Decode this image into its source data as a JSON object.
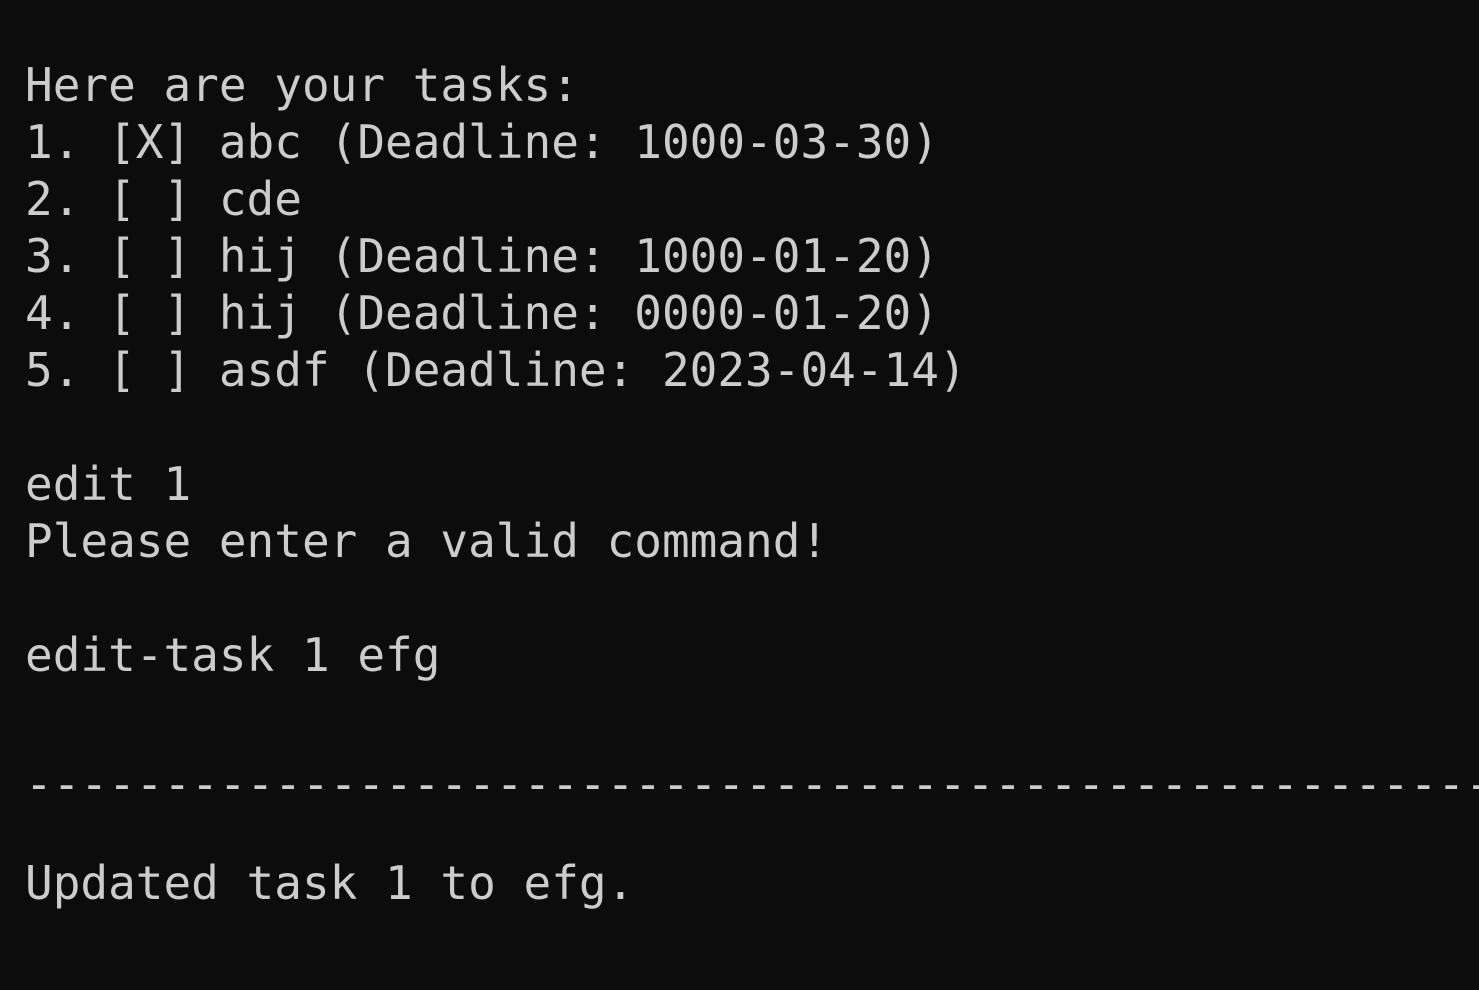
{
  "terminal": {
    "header": "Here are your tasks:",
    "tasks": [
      "1. [X] abc (Deadline: 1000-03-30)",
      "2. [ ] cde",
      "3. [ ] hij (Deadline: 1000-01-20)",
      "4. [ ] hij (Deadline: 0000-01-20)",
      "5. [ ] asdf (Deadline: 2023-04-14)"
    ],
    "command_1": "edit 1",
    "error_message": "Please enter a valid command!",
    "command_2": "edit-task 1 efg",
    "separator": "------------------------------------------------------------------------",
    "result_message": "Updated task 1 to efg."
  }
}
